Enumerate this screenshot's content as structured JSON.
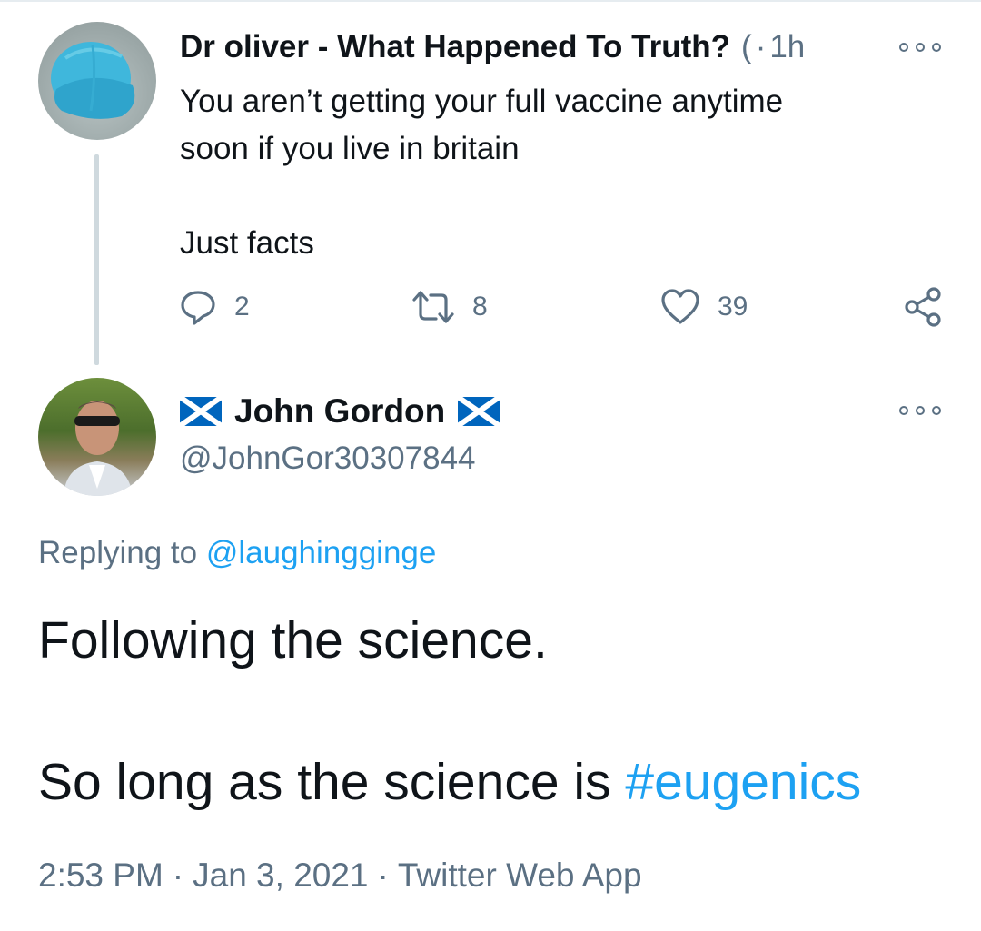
{
  "colors": {
    "text_primary": "#0f1419",
    "text_secondary": "#5b7083",
    "link": "#1da1f2",
    "thread_line": "#cfd9de"
  },
  "parent_tweet": {
    "author_name": "Dr oliver - What Happened To Truth?",
    "author_name_tail": "(",
    "separator": "·",
    "time_ago": "1h",
    "text_lines": [
      "You aren’t getting your full vaccine anytime",
      "soon if you live in britain"
    ],
    "text_line_2": "Just facts",
    "actions": {
      "reply": {
        "icon": "reply-icon",
        "count": "2"
      },
      "retweet": {
        "icon": "retweet-icon",
        "count": "8"
      },
      "like": {
        "icon": "heart-icon",
        "count": "39"
      },
      "share": {
        "icon": "share-icon"
      }
    }
  },
  "reply_tweet": {
    "author_name": "John Gordon",
    "name_emoji": "scotland-flag",
    "handle": "@JohnGor30307844",
    "replying_prefix": "Replying to",
    "replying_handle": "@laughingginge",
    "body_line_1": "Following the science.",
    "body_line_2_prefix": "So long as the science is",
    "body_hashtag": "#eugenics",
    "time": "2:53 PM",
    "date": "Jan 3, 2021",
    "source": "Twitter Web App",
    "meta_separator": "·"
  }
}
